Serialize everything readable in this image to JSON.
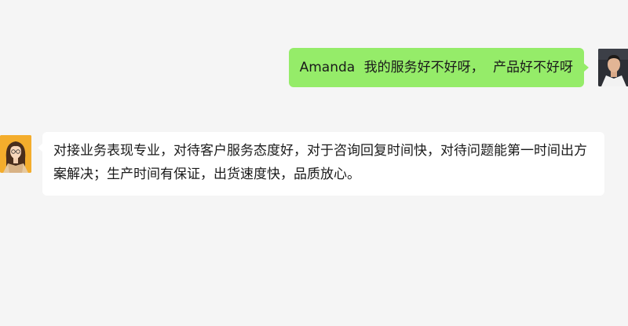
{
  "chat": {
    "messages": [
      {
        "sender": "me",
        "avatar_icon": "man-portrait-avatar",
        "text": "Amanda  我的服务好不好呀，  产品好不好呀"
      },
      {
        "sender": "customer",
        "avatar_icon": "woman-portrait-avatar",
        "text": "对接业务表现专业，对待客户服务态度好，对于咨询回复时间快，对待问题能第一时间出方案解决；生产时间有保证，出货速度快，品质放心。"
      }
    ]
  },
  "colors": {
    "background": "#f5f5f5",
    "outgoing_bubble": "#95ec69",
    "incoming_bubble": "#ffffff",
    "text": "#1a1a1a"
  }
}
